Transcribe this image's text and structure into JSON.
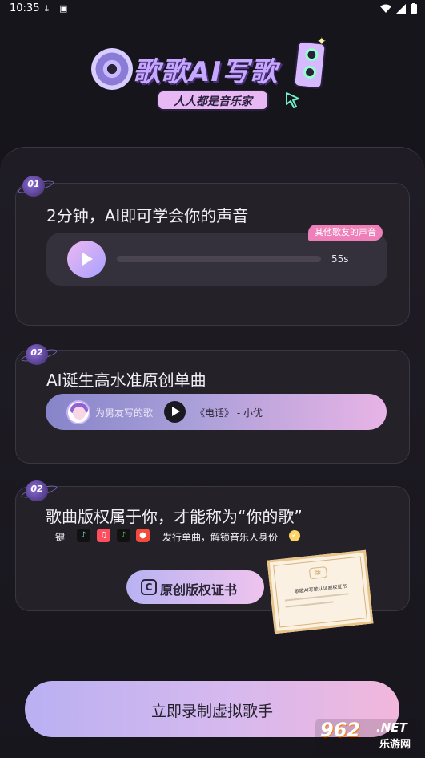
{
  "status_bar": {
    "time": "10:35",
    "icons_left": [
      "download-icon",
      "photo-icon"
    ],
    "icons_right": [
      "wifi-icon",
      "signal-icon",
      "battery-icon"
    ]
  },
  "header": {
    "title": "歌歌AI写歌",
    "subtitle": "人人都是音乐家"
  },
  "cards": [
    {
      "step": "01",
      "title": "2分钟，AI即可学会你的声音",
      "tag": "其他歌友的声音",
      "duration": "55s",
      "progress": 0
    },
    {
      "step": "02",
      "title": "AI诞生高水准原创单曲",
      "song_placeholder": "为男友写的歌",
      "song_name": "《电话》 - 小优"
    },
    {
      "step": "02",
      "title": "歌曲版权属于你，才能称为“你的歌”",
      "one_key": "一键",
      "platforms": [
        "douyin-icon",
        "qq-music-icon",
        "music-icon",
        "netease-music-icon"
      ],
      "release_text": "发行单曲，解锁音乐人身份",
      "cert_label": "原创版权证书",
      "cert_doc_title": "歌歌AI写歌认证原权证书",
      "cert_doc_seal": "版"
    }
  ],
  "cta": {
    "label": "立即录制虚拟歌手"
  },
  "watermark": {
    "number": "962",
    "net": ".NET",
    "cn": "乐游网"
  },
  "colors": {
    "background": "#17151c",
    "card": "#242129",
    "accent_purple": "#b9b0f2",
    "accent_pink": "#f2b7dc",
    "tag_pink": "#ef7fb8"
  }
}
